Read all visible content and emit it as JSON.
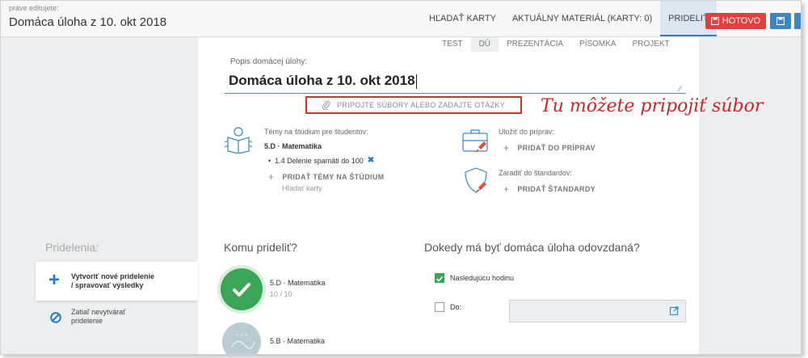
{
  "header": {
    "editing_caption": "práve editujete:",
    "title": "Domáca úloha z 10. okt 2018",
    "nav": [
      {
        "label": "HĽADAŤ KARTY"
      },
      {
        "label": "AKTUÁLNY MATERIÁL (KARTY: 0)"
      },
      {
        "label": "PRIDELIŤ"
      }
    ],
    "done_label": "HOTOVO"
  },
  "type_tabs": [
    {
      "label": "TEST"
    },
    {
      "label": "DÚ"
    },
    {
      "label": "PREZENTÁCIA"
    },
    {
      "label": "PÍSOMKA"
    },
    {
      "label": "PROJEKT"
    }
  ],
  "description": {
    "label": "Popis domácej úlohy:",
    "value": "Domáca úloha z 10. okt 2018"
  },
  "attach": {
    "label": "PRIPOJTE SÚBORY ALEBO ZADAJTE OTÁZKY",
    "annotation": "Tu môžete pripojiť súbor"
  },
  "topics": {
    "label": "Témy na štúdium pre študentov:",
    "class_name": "5.D · Matematika",
    "item": "1.4 Delenie spamäti do 100",
    "add_label": "PRIDAŤ TÉMY NA ŠTÚDIUM",
    "search": "Hľadať karty"
  },
  "save_prep": {
    "label": "Uložiť do príprav:",
    "add_label": "PRIDAŤ DO PRÍPRAV"
  },
  "standards": {
    "label": "Zaradiť do štandardov:",
    "add_label": "PRIDAŤ ŠTANDARDY"
  },
  "assignments_panel": {
    "heading": "Pridelenia:",
    "new_line1": "Vytvoriť nové pridelenie",
    "new_line2": "/ spravovať výsledky",
    "skip_line1": "Zatiaľ nevytvárať",
    "skip_line2": "pridelenie"
  },
  "assign_to": {
    "heading": "Komu prideliť?",
    "classes": [
      {
        "name": "5.D · Matematika",
        "count": "10 / 10",
        "checked": true
      },
      {
        "name": "5.B · Matematika",
        "checked": false
      }
    ]
  },
  "deadline": {
    "heading": "Dokedy má byť domáca úloha odovzdaná?",
    "next_lesson": "Nasledujúcu hodinu",
    "next_lesson_checked": true,
    "until_label": "Do:",
    "until_checked": false
  },
  "colors": {
    "accent_blue": "#3d86c6",
    "done_red": "#e53e3e",
    "highlight_red": "#c0392b",
    "check_green": "#3aa556"
  },
  "icons": {
    "attach": "paperclip-icon",
    "topics": "open-book-icon",
    "prep": "briefcase-pin-icon",
    "standards": "shield-pin-icon",
    "new_assignment": "plus-icon",
    "skip": "ban-icon",
    "date_picker": "external-edit-icon"
  }
}
